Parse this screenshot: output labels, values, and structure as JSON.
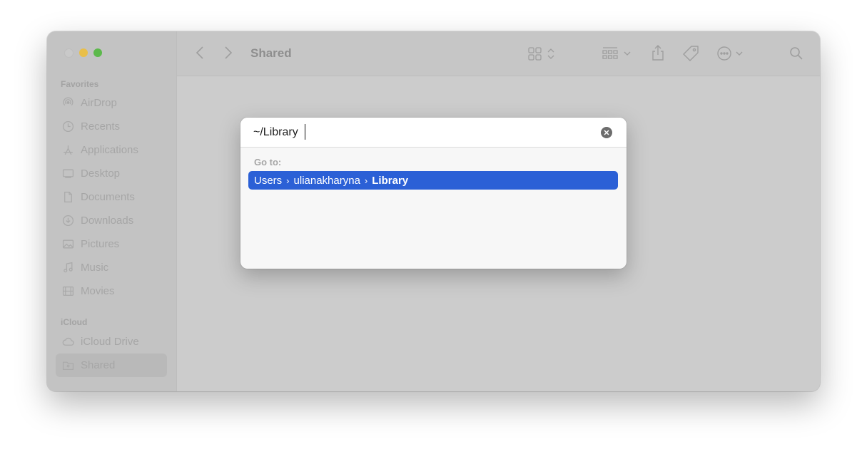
{
  "window": {
    "title": "Shared",
    "sidebar": {
      "sections": [
        {
          "label": "Favorites",
          "items": [
            {
              "label": "AirDrop",
              "icon": "airdrop-icon"
            },
            {
              "label": "Recents",
              "icon": "clock-icon"
            },
            {
              "label": "Applications",
              "icon": "applications-icon"
            },
            {
              "label": "Desktop",
              "icon": "desktop-icon"
            },
            {
              "label": "Documents",
              "icon": "document-icon"
            },
            {
              "label": "Downloads",
              "icon": "download-icon"
            },
            {
              "label": "Pictures",
              "icon": "pictures-icon"
            },
            {
              "label": "Music",
              "icon": "music-icon"
            },
            {
              "label": "Movies",
              "icon": "movies-icon"
            }
          ]
        },
        {
          "label": "iCloud",
          "items": [
            {
              "label": "iCloud Drive",
              "icon": "cloud-icon"
            },
            {
              "label": "Shared",
              "icon": "shared-folder-icon",
              "selected": true
            }
          ]
        }
      ]
    }
  },
  "goto_dialog": {
    "path_value": "~/Library",
    "goto_label": "Go to:",
    "suggestion": {
      "segments": [
        "Users",
        "ulianakharyna",
        "Library"
      ],
      "separator": "›"
    }
  },
  "colors": {
    "selection": "#2b60d6",
    "traffic_min": "#e9bf49",
    "traffic_max": "#5cb94b"
  }
}
